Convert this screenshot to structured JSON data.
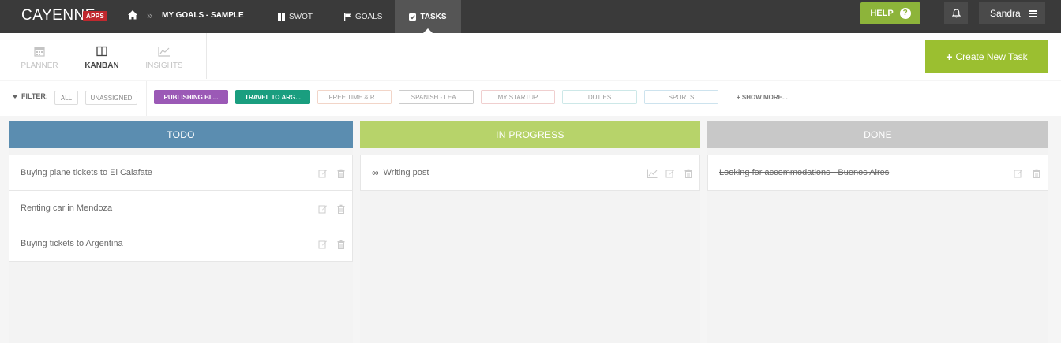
{
  "app": {
    "logo": "CAYENNE",
    "logo_badge": "APPS",
    "breadcrumb_title": "MY GOALS - SAMPLE",
    "breadcrumb_sep": "»"
  },
  "topnav": {
    "items": [
      {
        "label": "SWOT",
        "icon": "grid-icon"
      },
      {
        "label": "GOALS",
        "icon": "flag-icon"
      },
      {
        "label": "TASKS",
        "icon": "checkbox-icon",
        "active": true
      }
    ],
    "help_label": "HELP",
    "help_icon": "?",
    "user_name": "Sandra"
  },
  "subnav": {
    "items": [
      {
        "label": "PLANNER",
        "icon": "calendar-icon"
      },
      {
        "label": "KANBAN",
        "icon": "columns-icon",
        "active": true
      },
      {
        "label": "INSIGHTS",
        "icon": "chart-line-icon"
      }
    ],
    "create_label": "Create New Task"
  },
  "filters": {
    "label": "FILTER:",
    "all": "ALL",
    "unassigned": "UNASSIGNED",
    "tags": [
      {
        "label": "PUBLISHING BL...",
        "color": "#9b59b6"
      },
      {
        "label": "TRAVEL TO ARG...",
        "color": "#1a9e7f"
      },
      {
        "label": "FREE TIME & R...",
        "color": "#f2d5c8"
      },
      {
        "label": "SPANISH - LEA...",
        "color": "#cccccc"
      },
      {
        "label": "MY STARTUP",
        "color": "#f0cfcf"
      },
      {
        "label": "DUTIES",
        "color": "#cde8e8"
      },
      {
        "label": "SPORTS",
        "color": "#cde3ee"
      }
    ],
    "show_more": "+ SHOW MORE..."
  },
  "board": {
    "columns": [
      {
        "title": "TODO",
        "color": "#5b8db0",
        "cards": [
          "Buying plane tickets to El Calafate",
          "Renting car in Mendoza",
          "Buying tickets to Argentina"
        ]
      },
      {
        "title": "IN PROGRESS",
        "color": "#b7d36a",
        "cards": [
          "Writing post"
        ]
      },
      {
        "title": "DONE",
        "color": "#c8c8c8",
        "cards": [
          "Looking for accommodations - Buenos Aires"
        ]
      }
    ]
  }
}
